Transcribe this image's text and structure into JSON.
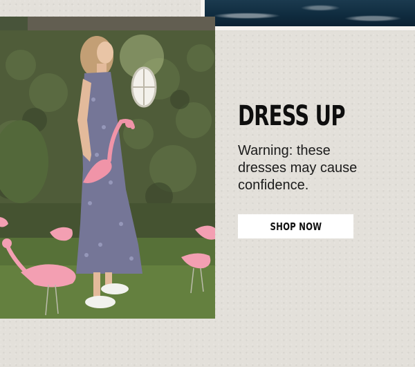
{
  "promo": {
    "headline": "DRESS UP",
    "body": "Warning: these dresses may cause confidence.",
    "cta_label": "SHOP NOW"
  },
  "images": {
    "hero": "photo of a woman in a floral maxi dress holding a pink flamingo lawn ornament in a garden",
    "top_strip": "ocean water photo"
  },
  "colors": {
    "background": "#e3e0da",
    "headline": "#0e0e0e",
    "button_bg": "#ffffff",
    "button_text": "#111111"
  }
}
